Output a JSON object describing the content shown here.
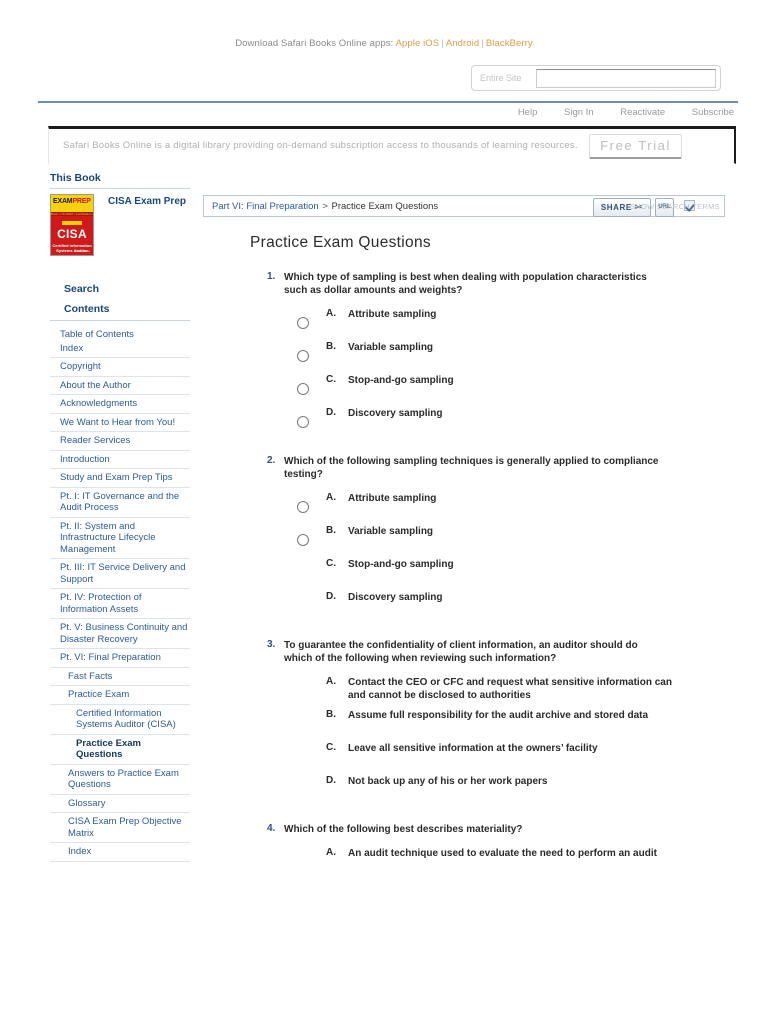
{
  "promo": {
    "label": "Download Safari Books Online apps:",
    "links": [
      "Apple iOS",
      "Android",
      "BlackBerry"
    ],
    "separator": "|"
  },
  "search": {
    "scope": "Entire Site",
    "value": "",
    "placeholder": ""
  },
  "account_nav": [
    {
      "label": "Help"
    },
    {
      "label": "Sign In"
    },
    {
      "label": "Reactivate"
    },
    {
      "label": "Subscribe"
    }
  ],
  "banner": {
    "text": "Safari Books Online is a digital library providing on-demand subscription access to thousands of learning resources.",
    "cta": "Free Trial"
  },
  "sidebar": {
    "heading": "This Book",
    "book": {
      "title": "CISA Exam Prep",
      "cover": {
        "brand_exam": "EXAM",
        "brand_prep": "PREP",
        "strip": "Book • CD-ROM • Certification • Practice Exams",
        "main": "CISA",
        "sub_line1": "Certified Information",
        "sub_line2": "Systems Auditor",
        "author": "Allen Keele"
      }
    },
    "search_label": "Search",
    "contents_label": "Contents",
    "toc": [
      {
        "label": "Table of Contents",
        "level": 1,
        "group": "a"
      },
      {
        "label": "Index",
        "level": 1,
        "group": "a"
      },
      {
        "label": "Copyright",
        "level": 1
      },
      {
        "label": "About the Author",
        "level": 1
      },
      {
        "label": "Acknowledgments",
        "level": 1
      },
      {
        "label": "We Want to Hear from You!",
        "level": 1
      },
      {
        "label": "Reader Services",
        "level": 1
      },
      {
        "label": "Introduction",
        "level": 1
      },
      {
        "label": "Study and Exam Prep Tips",
        "level": 1
      },
      {
        "label": "Pt. I: IT Governance and the Audit Process",
        "level": 1
      },
      {
        "label": "Pt. II: System and Infrastructure Lifecycle Management",
        "level": 1
      },
      {
        "label": "Pt. III: IT Service Delivery and Support",
        "level": 1
      },
      {
        "label": "Pt. IV: Protection of Information Assets",
        "level": 1
      },
      {
        "label": "Pt. V: Business Continuity and Disaster Recovery",
        "level": 1
      },
      {
        "label": "Pt. VI: Final Preparation",
        "level": 1
      },
      {
        "label": "Fast Facts",
        "level": 2
      },
      {
        "label": "Practice Exam",
        "level": 2
      },
      {
        "label": "Certified Information Systems Auditor (CISA)",
        "level": 3
      },
      {
        "label": "Practice Exam Questions",
        "level": 3,
        "current": true
      },
      {
        "label": "Answers to Practice Exam Questions",
        "level": 2
      },
      {
        "label": "Glossary",
        "level": 2
      },
      {
        "label": "CISA Exam Prep Objective Matrix",
        "level": 2
      },
      {
        "label": "Index",
        "level": 1
      }
    ]
  },
  "toolbar": {
    "breadcrumb_part": "Part VI: Final Preparation",
    "breadcrumb_sep": ">",
    "breadcrumb_current": "Practice Exam Questions",
    "share_label": "SHARE",
    "share_glyph": "✂",
    "url_label": "URL",
    "show_search_terms": "SHOW SEARCH TERMS"
  },
  "page": {
    "title": "Practice Exam Questions"
  },
  "questions": [
    {
      "number": "1.",
      "text": "Which type of sampling is best when dealing with population characteristics such as dollar amounts and weights?",
      "options": [
        {
          "letter": "A.",
          "text": "Attribute sampling",
          "radio": true
        },
        {
          "letter": "B.",
          "text": "Variable sampling",
          "radio": true
        },
        {
          "letter": "C.",
          "text": "Stop-and-go sampling",
          "radio": true
        },
        {
          "letter": "D.",
          "text": "Discovery sampling",
          "radio": true
        }
      ]
    },
    {
      "number": "2.",
      "text": "Which of the following sampling techniques is generally applied to compliance testing?",
      "options": [
        {
          "letter": "A.",
          "text": "Attribute sampling",
          "radio": true
        },
        {
          "letter": "B.",
          "text": "Variable sampling",
          "radio": true
        },
        {
          "letter": "C.",
          "text": "Stop-and-go sampling",
          "radio": false
        },
        {
          "letter": "D.",
          "text": "Discovery sampling",
          "radio": false
        }
      ]
    },
    {
      "number": "3.",
      "text": "To guarantee the confidentiality of client information, an auditor should do which of the following when reviewing such information?",
      "options": [
        {
          "letter": "A.",
          "text": "Contact the CEO or CFC and request what sensitive information can and cannot be disclosed to authorities",
          "radio": false
        },
        {
          "letter": "B.",
          "text": "Assume full responsibility for the audit archive and stored data",
          "radio": false
        },
        {
          "letter": "C.",
          "text": "Leave all sensitive information at the owners’ facility",
          "radio": false
        },
        {
          "letter": "D.",
          "text": "Not back up any of his or her work papers",
          "radio": false
        }
      ]
    },
    {
      "number": "4.",
      "text": "Which of the following best describes materiality?",
      "options": [
        {
          "letter": "A.",
          "text": "An audit technique used to evaluate the need to perform an audit",
          "radio": false
        }
      ]
    }
  ]
}
